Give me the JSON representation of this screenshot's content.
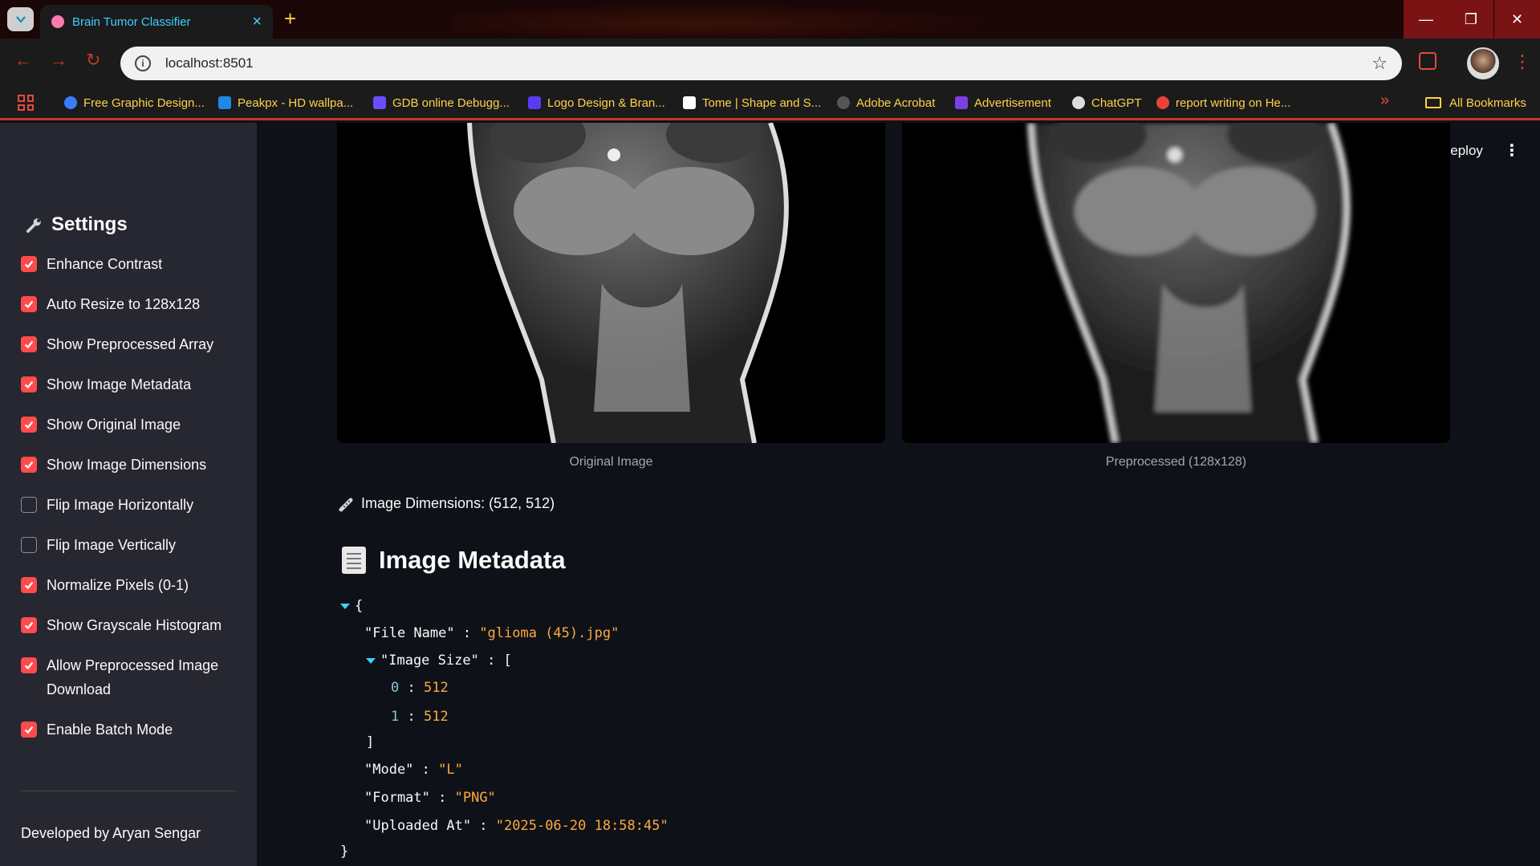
{
  "browser": {
    "tab_title": "Brain Tumor Classifier",
    "url": "localhost:8501",
    "bookmarks": [
      {
        "label": "Free Graphic Design...",
        "color": "#3b7cff"
      },
      {
        "label": "Peakpx - HD wallpa...",
        "color": "#1e88e5"
      },
      {
        "label": "GDB online Debugg...",
        "color": "#6b4cff"
      },
      {
        "label": "Logo Design & Bran...",
        "color": "#5a3cf0"
      },
      {
        "label": "Tome | Shape and S...",
        "color": "#ffffff"
      },
      {
        "label": "Adobe Acrobat",
        "color": "#555555"
      },
      {
        "label": "Advertisement",
        "color": "#7b3fe4"
      },
      {
        "label": "ChatGPT",
        "color": "#dddddd"
      },
      {
        "label": "report writing on He...",
        "color": "#ea4335"
      }
    ],
    "all_bookmarks": "All Bookmarks"
  },
  "header": {
    "deploy_label": "Deploy"
  },
  "sidebar": {
    "title": "Settings",
    "options": [
      {
        "label": "Enhance Contrast",
        "checked": true
      },
      {
        "label": "Auto Resize to 128x128",
        "checked": true
      },
      {
        "label": "Show Preprocessed Array",
        "checked": true
      },
      {
        "label": "Show Image Metadata",
        "checked": true
      },
      {
        "label": "Show Original Image",
        "checked": true
      },
      {
        "label": "Show Image Dimensions",
        "checked": true
      },
      {
        "label": "Flip Image Horizontally",
        "checked": false
      },
      {
        "label": "Flip Image Vertically",
        "checked": false
      },
      {
        "label": "Normalize Pixels (0-1)",
        "checked": true
      },
      {
        "label": "Show Grayscale Histogram",
        "checked": true
      },
      {
        "label": "Allow Preprocessed Image Download",
        "checked": true
      },
      {
        "label": "Enable Batch Mode",
        "checked": true
      }
    ],
    "footer": "Developed by Aryan Sengar"
  },
  "main": {
    "original_caption": "Original Image",
    "preprocessed_caption": "Preprocessed (128x128)",
    "dimensions_text": "Image Dimensions: (512, 512)",
    "metadata_heading": "Image Metadata",
    "metadata": {
      "file_name_key": "\"File Name\"",
      "file_name": "\"glioma (45).jpg\"",
      "image_size_key": "\"Image Size\"",
      "image_size": [
        "512",
        "512"
      ],
      "mode_key": "\"Mode\"",
      "mode": "\"L\"",
      "format_key": "\"Format\"",
      "format": "\"PNG\"",
      "uploaded_key": "\"Uploaded At\"",
      "uploaded": "\"2025-06-20 18:58:45\""
    }
  },
  "colors": {
    "accent": "#ff4b4b",
    "sidebar_bg": "#262730",
    "main_bg": "#0e1117",
    "json_string": "#ffa940",
    "tab_text": "#3ed0ff"
  }
}
